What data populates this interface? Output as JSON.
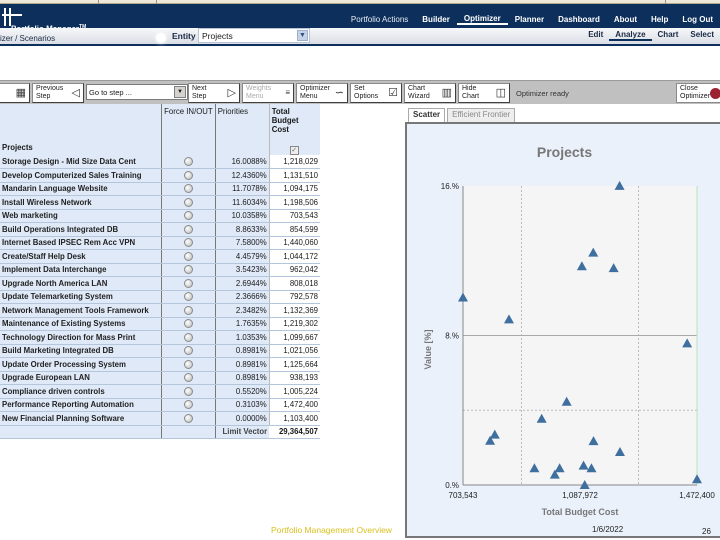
{
  "app": {
    "brand": "Portfolio Manager",
    "trademark": "TM",
    "breadcrumb": "izer / Scenarios"
  },
  "nav": {
    "items": [
      {
        "label": "Portfolio Actions",
        "style": "plain"
      },
      {
        "label": "Builder"
      },
      {
        "label": "Optimizer",
        "active": true
      },
      {
        "label": "Planner"
      },
      {
        "label": "Dashboard"
      },
      {
        "label": "About"
      },
      {
        "label": "Help"
      },
      {
        "label": "Log Out"
      }
    ]
  },
  "entity": {
    "label": "Entity",
    "value": "Projects"
  },
  "subnav": {
    "items": [
      {
        "label": "Edit"
      },
      {
        "label": "Analyze",
        "active": true
      },
      {
        "label": "Chart"
      },
      {
        "label": "Select"
      }
    ]
  },
  "toolbar": {
    "previous_step": "Previous Step",
    "goto_step_placeholder": "Go to step ...",
    "next_step": "Next Step",
    "weights_menu": "Weights Menu",
    "optimizer_menu": "Optimizer Menu",
    "set_options": "Set Options",
    "chart_wizard": "Chart Wizard",
    "hide_chart": "Hide Chart",
    "status": "Optimizer ready",
    "close_optimizer": "Close Optimizer"
  },
  "table": {
    "headers": {
      "projects": "Projects",
      "force": "Force IN/OUT",
      "priorities": "Priorities",
      "total_budget_cost": "Total Budget Cost"
    },
    "rows": [
      {
        "name": "Storage Design - Mid Size Data Cent",
        "priority": "16.0088%",
        "cost": "1,218,029"
      },
      {
        "name": "Develop Computerized Sales Training",
        "priority": "12.4360%",
        "cost": "1,131,510"
      },
      {
        "name": "Mandarin Language Website",
        "priority": "11.7078%",
        "cost": "1,094,175"
      },
      {
        "name": "Install Wireless Network",
        "priority": "11.6034%",
        "cost": "1,198,506"
      },
      {
        "name": "Web marketing",
        "priority": "10.0358%",
        "cost": "703,543"
      },
      {
        "name": "Build Operations Integrated DB",
        "priority": "8.8633%",
        "cost": "854,599"
      },
      {
        "name": "Internet Based IPSEC Rem Acc VPN",
        "priority": "7.5800%",
        "cost": "1,440,060"
      },
      {
        "name": "Create/Staff Help Desk",
        "priority": "4.4579%",
        "cost": "1,044,172"
      },
      {
        "name": "Implement Data Interchange",
        "priority": "3.5423%",
        "cost": "962,042"
      },
      {
        "name": "Upgrade North America LAN",
        "priority": "2.6944%",
        "cost": "808,018"
      },
      {
        "name": "Update Telemarketing System",
        "priority": "2.3666%",
        "cost": "792,578"
      },
      {
        "name": "Network Management Tools Framework",
        "priority": "2.3482%",
        "cost": "1,132,369"
      },
      {
        "name": "Maintenance of Existing Systems",
        "priority": "1.7635%",
        "cost": "1,219,302"
      },
      {
        "name": "Technology Direction for Mass Print",
        "priority": "1.0353%",
        "cost": "1,099,667"
      },
      {
        "name": "Build Marketing Integrated DB",
        "priority": "0.8981%",
        "cost": "1,021,056"
      },
      {
        "name": "Update Order Processing System",
        "priority": "0.8981%",
        "cost": "1,125,664"
      },
      {
        "name": "Upgrade European LAN",
        "priority": "0.8981%",
        "cost": "938,193"
      },
      {
        "name": "Compliance driven controls",
        "priority": "0.5520%",
        "cost": "1,005,224"
      },
      {
        "name": "Performance Reporting Automation",
        "priority": "0.3103%",
        "cost": "1,472,400"
      },
      {
        "name": "New Financial Planning Software",
        "priority": "0.0000%",
        "cost": "1,103,400"
      }
    ],
    "footer": {
      "label": "Limit Vector",
      "total": "29,364,507"
    }
  },
  "chart_tabs": [
    {
      "label": "Scatter",
      "active": true
    },
    {
      "label": "Efficient Frontier"
    }
  ],
  "chart_data": {
    "type": "scatter",
    "title": "Projects",
    "xlabel": "Total Budget Cost",
    "ylabel": "Value [%]",
    "xlim": [
      703543,
      1472400
    ],
    "ylim": [
      0,
      16
    ],
    "x_ticks": [
      "703,543",
      "1,087,972",
      "1,472,400"
    ],
    "y_ticks": [
      "0.%",
      "8.%",
      "16.%"
    ],
    "marker": "triangle",
    "marker_color": "#3f6f9f",
    "grid": true,
    "points": [
      {
        "x": 1218029,
        "y": 16.0088
      },
      {
        "x": 1131510,
        "y": 12.436
      },
      {
        "x": 1094175,
        "y": 11.7078
      },
      {
        "x": 1198506,
        "y": 11.6034
      },
      {
        "x": 703543,
        "y": 10.0358
      },
      {
        "x": 854599,
        "y": 8.8633
      },
      {
        "x": 1440060,
        "y": 7.58
      },
      {
        "x": 1044172,
        "y": 4.4579
      },
      {
        "x": 962042,
        "y": 3.5423
      },
      {
        "x": 808018,
        "y": 2.6944
      },
      {
        "x": 792578,
        "y": 2.3666
      },
      {
        "x": 1132369,
        "y": 2.3482
      },
      {
        "x": 1219302,
        "y": 1.7635
      },
      {
        "x": 1099667,
        "y": 1.0353
      },
      {
        "x": 1021056,
        "y": 0.8981
      },
      {
        "x": 1125664,
        "y": 0.8981
      },
      {
        "x": 938193,
        "y": 0.8981
      },
      {
        "x": 1005224,
        "y": 0.552
      },
      {
        "x": 1472400,
        "y": 0.3103
      },
      {
        "x": 1103400,
        "y": 0.0
      }
    ]
  },
  "footer": {
    "title": "Portfolio Management Overview",
    "date": "1/6/2022",
    "page": "26"
  }
}
